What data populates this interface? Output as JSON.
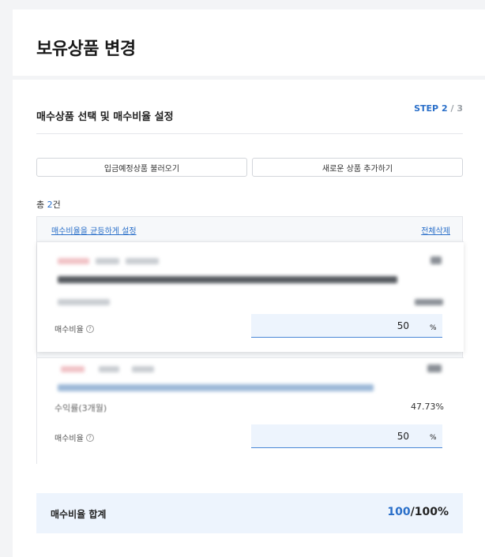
{
  "header": {
    "title": "보유상품 변경"
  },
  "section": {
    "title": "매수상품 선택 및 매수비율 설정",
    "step_label": "STEP",
    "step_current": "2",
    "step_separator": "/",
    "step_total": "3"
  },
  "actions": {
    "load_label": "입금예정상품 불러오기",
    "add_label": "새로운 상품 추가하기"
  },
  "list": {
    "total_prefix": "총",
    "total_count": "2",
    "total_suffix": "건",
    "equal_ratio_label": "매수비율을 균등하게 설정",
    "delete_all_label": "전체삭제"
  },
  "products": [
    {
      "rate_label": "매수비율",
      "help_icon": "question-circle-icon",
      "rate_value": "50",
      "rate_unit": "%"
    },
    {
      "return_label": "수익률(3개월)",
      "return_value": "47.73%",
      "rate_label": "매수비율",
      "help_icon": "question-circle-icon",
      "rate_value": "50",
      "rate_unit": "%"
    }
  ],
  "summary": {
    "label": "매수비율 합계",
    "value": "100",
    "total": "/100%"
  },
  "colors": {
    "accent": "#2a6fc9",
    "input_bg": "#edf4fd",
    "page_bg": "#f3f4f6"
  }
}
